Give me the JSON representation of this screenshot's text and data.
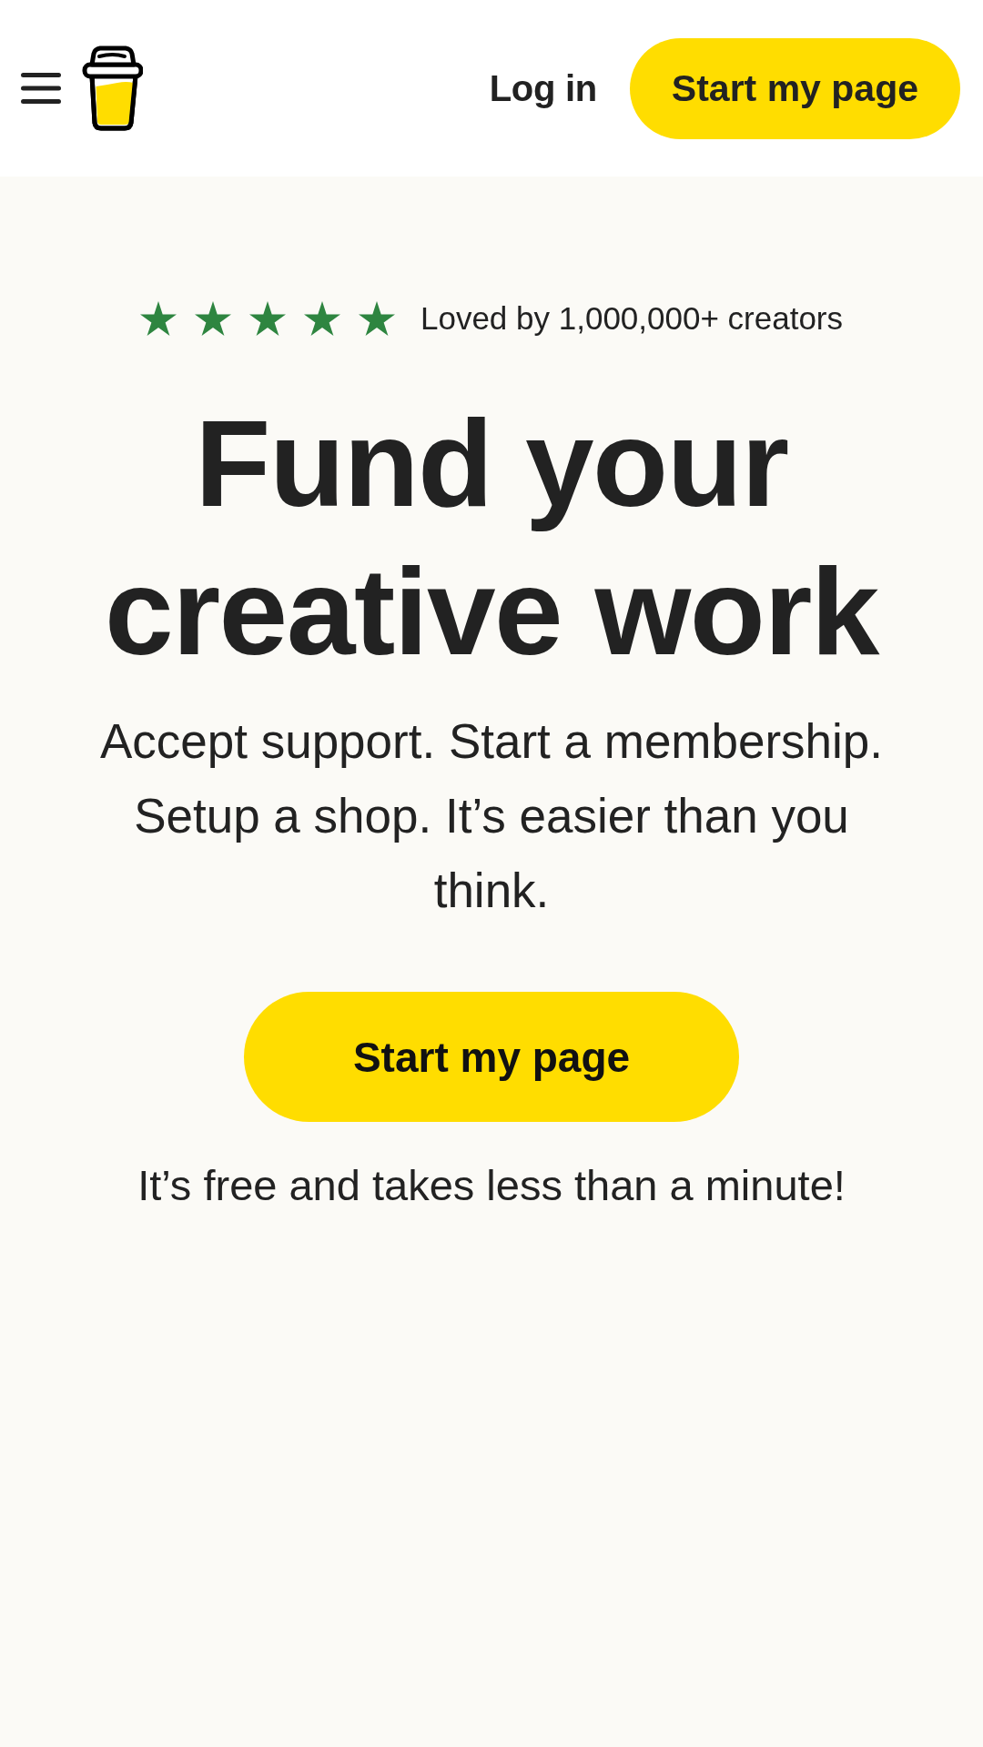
{
  "header": {
    "login": "Log in",
    "cta": "Start my page"
  },
  "hero": {
    "rating": {
      "stars": 5,
      "label": "Loved by 1,000,000+ creators"
    },
    "title": "Fund your creative work",
    "subtitle": "Accept support. Start a membership. Setup a shop. It’s easier than you think.",
    "cta": "Start my page",
    "note": "It’s free and takes less than a minute!"
  }
}
